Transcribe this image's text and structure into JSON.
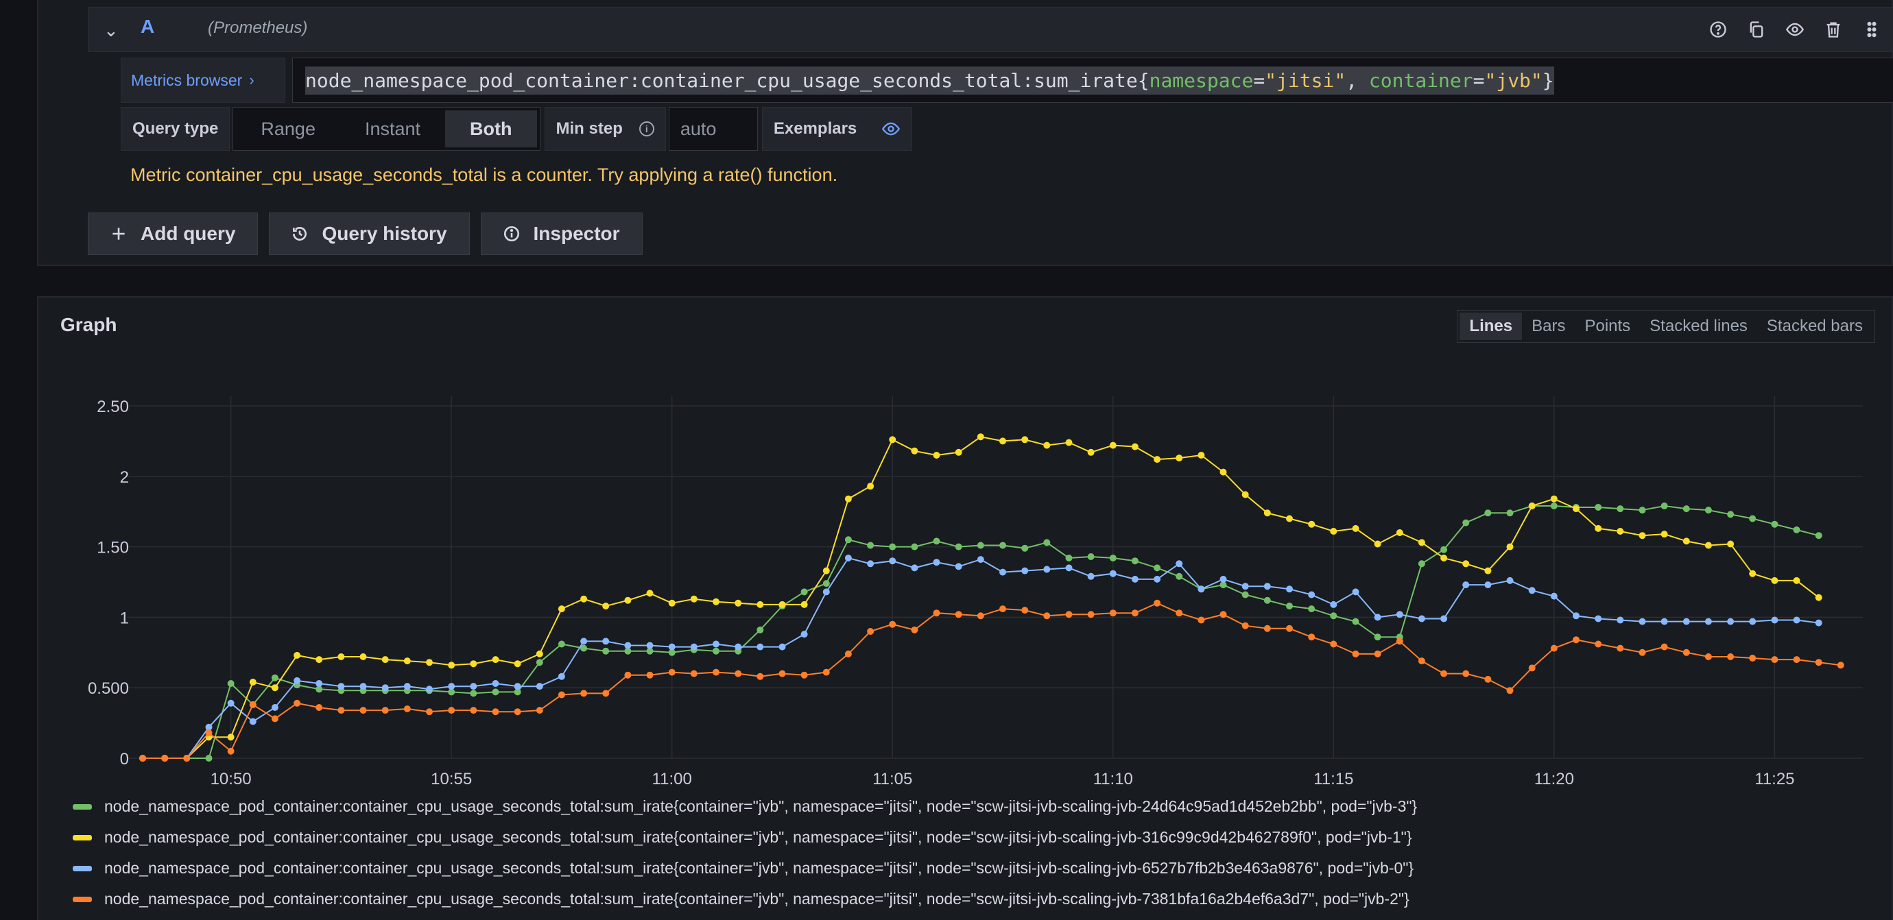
{
  "query": {
    "letter": "A",
    "datasource": "(Prometheus)",
    "metrics_browser_label": "Metrics browser",
    "metrics_browser_arrow": "›",
    "expr_metric": "node_namespace_pod_container:container_cpu_usage_seconds_total:sum_irate{",
    "expr_label1": "namespace",
    "expr_eq1": "=",
    "expr_val1": "\"jitsi\"",
    "expr_sep": ", ",
    "expr_label2": "container",
    "expr_eq2": "=",
    "expr_val2": "\"jvb\"",
    "expr_close": "}",
    "query_type_label": "Query type",
    "query_type_options": [
      "Range",
      "Instant",
      "Both"
    ],
    "query_type_selected": "Both",
    "min_step_label": "Min step",
    "min_step_placeholder": "auto",
    "exemplars_label": "Exemplars",
    "warning": "Metric container_cpu_usage_seconds_total is a counter. Try applying a rate() function."
  },
  "actions": {
    "add_query": "Add query",
    "query_history": "Query history",
    "inspector": "Inspector"
  },
  "graph": {
    "title": "Graph",
    "viz_options": [
      "Lines",
      "Bars",
      "Points",
      "Stacked lines",
      "Stacked bars"
    ],
    "viz_selected": "Lines"
  },
  "chart_data": {
    "type": "line",
    "title": "",
    "xlabel": "",
    "ylabel": "",
    "ylim": [
      0,
      2.5
    ],
    "y_ticks": [
      {
        "v": 0,
        "label": "0"
      },
      {
        "v": 0.5,
        "label": "0.500"
      },
      {
        "v": 1,
        "label": "1"
      },
      {
        "v": 1.5,
        "label": "1.50"
      },
      {
        "v": 2,
        "label": "2"
      },
      {
        "v": 2.5,
        "label": "2.50"
      }
    ],
    "x_ticks": [
      "10:50",
      "10:55",
      "11:00",
      "11:05",
      "11:10",
      "11:15",
      "11:20",
      "11:25"
    ],
    "x_start_time": "10:48",
    "x_step_seconds": 30,
    "grid": true,
    "series": [
      {
        "name": "node_namespace_pod_container:container_cpu_usage_seconds_total:sum_irate{container=\"jvb\", namespace=\"jitsi\", node=\"scw-jitsi-jvb-scaling-jvb-24d64c95ad1d452eb2bb\", pod=\"jvb-3\"}",
        "color": "#73bf69",
        "values": [
          0,
          0,
          0,
          0,
          0.53,
          0.38,
          0.57,
          0.52,
          0.49,
          0.48,
          0.48,
          0.48,
          0.48,
          0.48,
          0.47,
          0.46,
          0.47,
          0.47,
          0.68,
          0.81,
          0.78,
          0.76,
          0.76,
          0.76,
          0.75,
          0.77,
          0.76,
          0.76,
          0.91,
          1.08,
          1.18,
          1.24,
          1.55,
          1.51,
          1.5,
          1.5,
          1.54,
          1.5,
          1.51,
          1.51,
          1.49,
          1.53,
          1.42,
          1.43,
          1.42,
          1.4,
          1.35,
          1.29,
          1.2,
          1.23,
          1.16,
          1.12,
          1.08,
          1.06,
          1.01,
          0.97,
          0.86,
          0.86,
          1.38,
          1.48,
          1.67,
          1.74,
          1.74,
          1.79,
          1.79,
          1.78,
          1.78,
          1.77,
          1.76,
          1.79,
          1.77,
          1.76,
          1.73,
          1.7,
          1.66,
          1.62,
          1.58
        ]
      },
      {
        "name": "node_namespace_pod_container:container_cpu_usage_seconds_total:sum_irate{container=\"jvb\", namespace=\"jitsi\", node=\"scw-jitsi-jvb-scaling-jvb-316c99c9d42b462789f0\", pod=\"jvb-1\"}",
        "color": "#fade2a",
        "values": [
          0,
          0,
          0,
          0.15,
          0.15,
          0.54,
          0.5,
          0.73,
          0.7,
          0.72,
          0.72,
          0.7,
          0.69,
          0.68,
          0.66,
          0.67,
          0.7,
          0.67,
          0.74,
          1.06,
          1.13,
          1.08,
          1.12,
          1.17,
          1.1,
          1.13,
          1.11,
          1.1,
          1.09,
          1.09,
          1.09,
          1.33,
          1.84,
          1.93,
          2.26,
          2.18,
          2.15,
          2.17,
          2.28,
          2.25,
          2.26,
          2.22,
          2.24,
          2.17,
          2.22,
          2.21,
          2.12,
          2.13,
          2.15,
          2.03,
          1.87,
          1.74,
          1.7,
          1.66,
          1.61,
          1.63,
          1.52,
          1.6,
          1.53,
          1.42,
          1.38,
          1.33,
          1.5,
          1.79,
          1.84,
          1.77,
          1.63,
          1.61,
          1.58,
          1.59,
          1.54,
          1.51,
          1.52,
          1.31,
          1.26,
          1.26,
          1.14
        ]
      },
      {
        "name": "node_namespace_pod_container:container_cpu_usage_seconds_total:sum_irate{container=\"jvb\", namespace=\"jitsi\", node=\"scw-jitsi-jvb-scaling-jvb-6527b7fb2b3e463a9876\", pod=\"jvb-0\"}",
        "color": "#8ab8ff",
        "values": [
          0,
          0,
          0,
          0.22,
          0.39,
          0.26,
          0.36,
          0.55,
          0.53,
          0.51,
          0.51,
          0.5,
          0.51,
          0.49,
          0.51,
          0.51,
          0.53,
          0.51,
          0.51,
          0.58,
          0.83,
          0.83,
          0.8,
          0.8,
          0.79,
          0.79,
          0.81,
          0.79,
          0.79,
          0.79,
          0.88,
          1.18,
          1.42,
          1.38,
          1.4,
          1.35,
          1.39,
          1.36,
          1.41,
          1.32,
          1.33,
          1.34,
          1.35,
          1.29,
          1.31,
          1.27,
          1.27,
          1.38,
          1.2,
          1.27,
          1.22,
          1.22,
          1.2,
          1.16,
          1.09,
          1.18,
          1.0,
          1.02,
          0.99,
          0.99,
          1.23,
          1.23,
          1.26,
          1.19,
          1.15,
          1.01,
          0.99,
          0.98,
          0.97,
          0.97,
          0.97,
          0.97,
          0.97,
          0.97,
          0.98,
          0.98,
          0.96
        ]
      },
      {
        "name": "node_namespace_pod_container:container_cpu_usage_seconds_total:sum_irate{container=\"jvb\", namespace=\"jitsi\", node=\"scw-jitsi-jvb-scaling-jvb-7381bfa16a2b4ef6a3d7\", pod=\"jvb-2\"}",
        "color": "#ff7f2a",
        "values": [
          0,
          0,
          0,
          0.18,
          0.05,
          0.38,
          0.28,
          0.39,
          0.36,
          0.34,
          0.34,
          0.34,
          0.35,
          0.33,
          0.34,
          0.34,
          0.33,
          0.33,
          0.34,
          0.45,
          0.46,
          0.46,
          0.59,
          0.59,
          0.61,
          0.6,
          0.61,
          0.6,
          0.58,
          0.6,
          0.59,
          0.61,
          0.74,
          0.9,
          0.95,
          0.91,
          1.03,
          1.02,
          1.01,
          1.06,
          1.05,
          1.01,
          1.02,
          1.02,
          1.03,
          1.03,
          1.1,
          1.03,
          0.98,
          1.02,
          0.94,
          0.92,
          0.92,
          0.86,
          0.81,
          0.74,
          0.74,
          0.83,
          0.69,
          0.6,
          0.6,
          0.56,
          0.48,
          0.64,
          0.78,
          0.84,
          0.81,
          0.78,
          0.75,
          0.79,
          0.75,
          0.72,
          0.72,
          0.71,
          0.7,
          0.7,
          0.68,
          0.66
        ]
      }
    ]
  }
}
